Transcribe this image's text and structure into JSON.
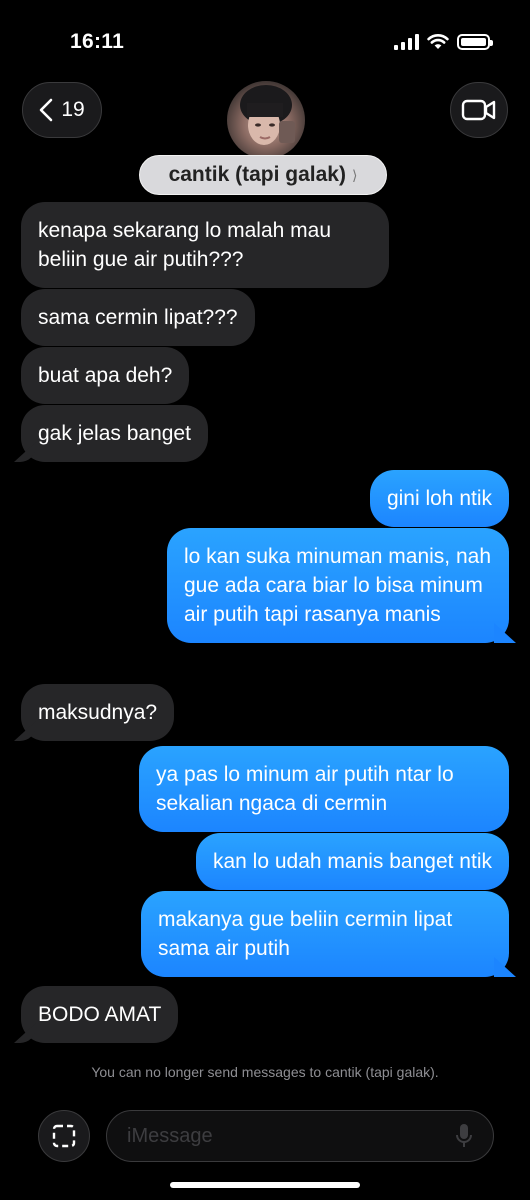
{
  "status_bar": {
    "time": "16:11",
    "battery_level": 1.0
  },
  "header": {
    "back_count": "19",
    "contact_name": "cantik (tapi galak)",
    "chevron": "⟩"
  },
  "messages": [
    {
      "from": "them",
      "text": "kenapa sekarang lo malah mau beliin gue air putih???"
    },
    {
      "from": "them",
      "text": "sama cermin lipat???"
    },
    {
      "from": "them",
      "text": "buat apa deh?"
    },
    {
      "from": "them",
      "text": "gak jelas banget"
    },
    {
      "from": "me",
      "text": "gini loh ntik"
    },
    {
      "from": "me",
      "text": "lo kan suka minuman manis, nah gue ada cara biar lo bisa minum air putih tapi rasanya manis"
    },
    {
      "from": "them",
      "text": "maksudnya?"
    },
    {
      "from": "me",
      "text": "ya pas lo minum air putih ntar lo sekalian ngaca di cermin"
    },
    {
      "from": "me",
      "text": "kan lo udah manis banget ntik"
    },
    {
      "from": "me",
      "text": "makanya gue beliin cermin lipat sama air putih"
    },
    {
      "from": "them",
      "text": "BODO AMAT"
    }
  ],
  "notice": "You can no longer send messages to cantik (tapi galak).",
  "composer": {
    "placeholder": "iMessage"
  },
  "colors": {
    "sent_bubble": "#1c85ff",
    "received_bubble": "#262628",
    "background": "#000000"
  },
  "icons": {
    "back": "chevron-left-icon",
    "video": "video-camera-icon",
    "apps": "apps-icon",
    "mic": "microphone-icon"
  }
}
